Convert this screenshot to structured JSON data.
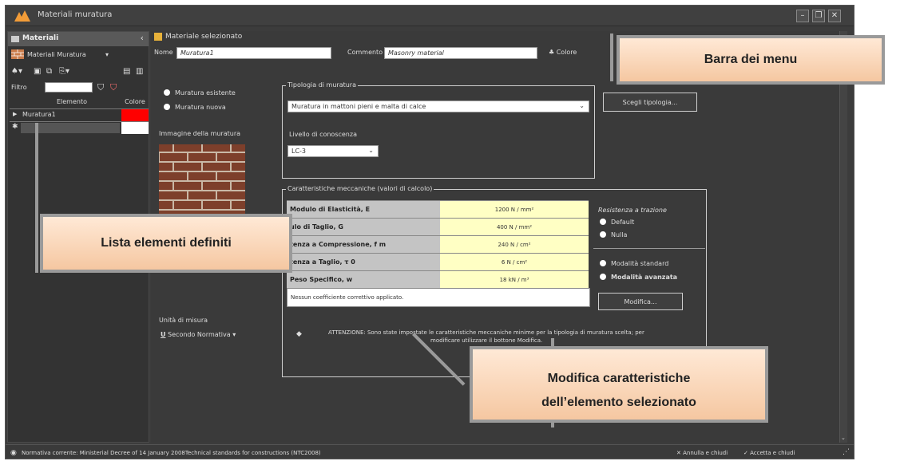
{
  "window": {
    "title": "Materiali muratura"
  },
  "left": {
    "header": "Materiali",
    "menu": "Materiali Muratura",
    "filter_label": "Filtro",
    "col_element": "Elemento",
    "col_color": "Colore",
    "rows": [
      {
        "name": "Muratura1",
        "color": "#ff0000"
      },
      {
        "name": "",
        "color": "#ffffff"
      }
    ]
  },
  "right": {
    "header": "Materiale selezionato",
    "name_label": "Nome",
    "name_value": "Muratura1",
    "comment_label": "Commento",
    "comment_value": "Masonry material",
    "color_button": "Colore",
    "radio_existing": "Muratura esistente",
    "radio_new": "Muratura nuova",
    "image_label": "Immagine della muratura",
    "typology_title": "Tipologia di muratura",
    "typology_value": "Muratura in mattoni pieni e malta di calce",
    "choose_button": "Scegli tipologia...",
    "knowledge_label": "Livello di conoscenza",
    "knowledge_value": "LC-3",
    "mech_title": "Caratteristiche meccaniche (valori di calcolo)",
    "mech_rows": [
      {
        "label": "Modulo di Elasticità, E",
        "value": "1200 N / mm²"
      },
      {
        "label": "ulo di Taglio, G",
        "value": "400 N / mm²"
      },
      {
        "label": "tenza a Compressione, f m",
        "value": "240 N / cm²"
      },
      {
        "label": "tenza a Taglio, τ 0",
        "value": "6 N / cm²"
      },
      {
        "label": "Peso Specifico, w",
        "value": "18 kN / m³"
      }
    ],
    "no_coeff": "Nessun coefficiente correttivo applicato.",
    "tension_title": "Resistenza a trazione",
    "tension_default": "Default",
    "tension_null": "Nulla",
    "mode_standard": "Modalità standard",
    "mode_advanced": "Modalità avanzata",
    "modify_button": "Modifica...",
    "units_label": "Unità di misura",
    "units_value": "Secondo Normativa",
    "warning_line1": "ATTENZIONE: Sono state impostate le caratteristiche meccaniche minime per la tipologia di muratura scelta; per",
    "warning_line2": "modificare utilizzare il bottone Modifica."
  },
  "status": {
    "normative": "Normativa corrente:  Ministerial Decree of 14 January 2008Technical standards for constructions (NTC2008)",
    "cancel": "Annulla e chiudi",
    "accept": "Accetta e chiudi"
  },
  "callouts": {
    "menu_bar": "Barra dei menu",
    "element_list": "Lista elementi definiti",
    "modify_line1": "Modifica caratteristiche",
    "modify_line2": "dell’elemento selezionato"
  },
  "colors": {
    "accent": "#f5c7a1",
    "window_bg": "#3c3c3c",
    "value_cell": "#ffffc4"
  }
}
